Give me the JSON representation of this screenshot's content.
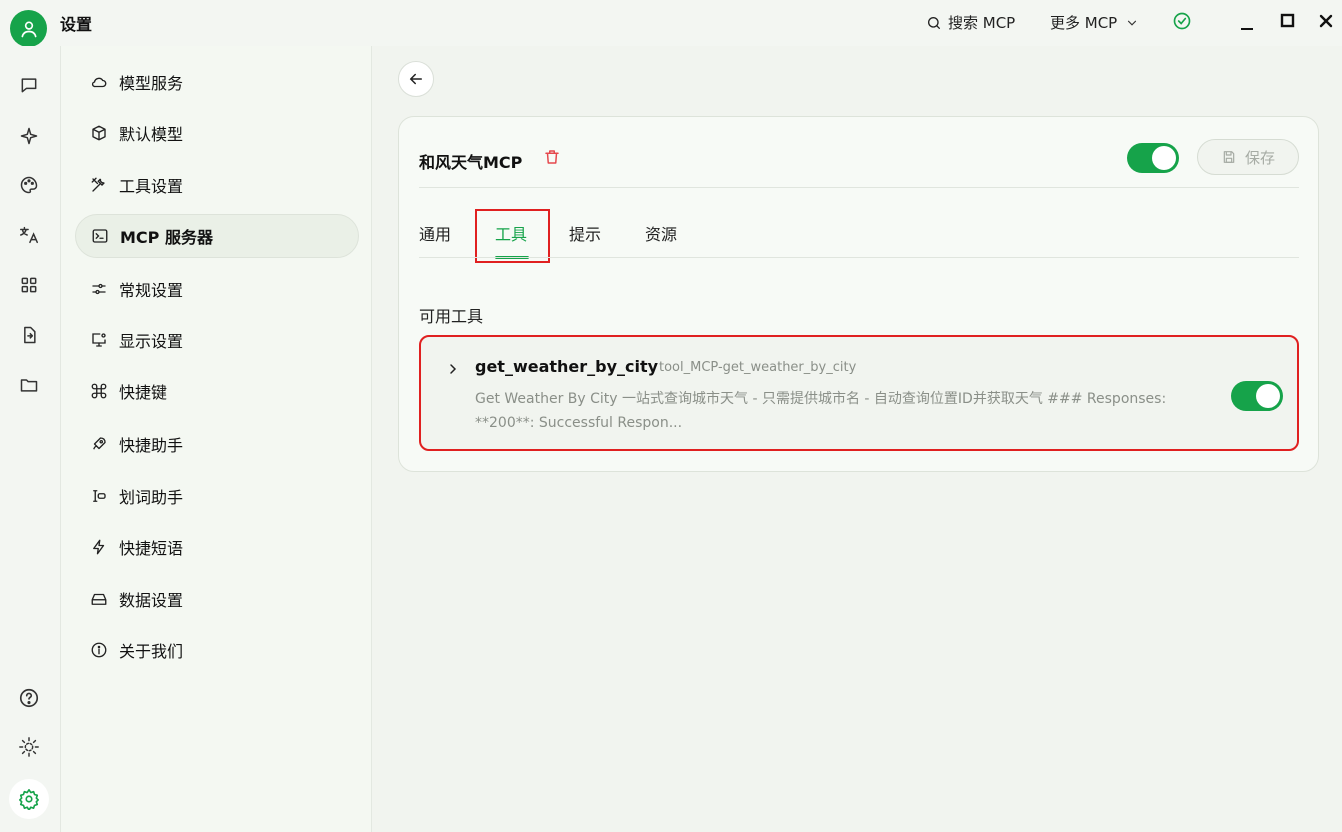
{
  "app": {
    "title": "设置"
  },
  "topbar": {
    "search_label": "搜索 MCP",
    "more_label": "更多 MCP"
  },
  "rail": {
    "icons": [
      "chat-icon",
      "sparkle-icon",
      "palette-icon",
      "translate-icon",
      "apps-icon",
      "file-transfer-icon",
      "folder-icon",
      "help-icon",
      "theme-icon",
      "settings-icon"
    ]
  },
  "menu": {
    "items": [
      {
        "label": "模型服务",
        "icon": "cloud-icon"
      },
      {
        "label": "默认模型",
        "icon": "cube-icon"
      },
      {
        "label": "工具设置",
        "icon": "tools-icon"
      },
      {
        "label": "MCP 服务器",
        "icon": "terminal-icon"
      },
      {
        "label": "常规设置",
        "icon": "sliders-icon"
      },
      {
        "label": "显示设置",
        "icon": "monitor-icon"
      },
      {
        "label": "快捷键",
        "icon": "command-icon"
      },
      {
        "label": "快捷助手",
        "icon": "rocket-icon"
      },
      {
        "label": "划词助手",
        "icon": "text-cursor-icon"
      },
      {
        "label": "快捷短语",
        "icon": "zap-icon"
      },
      {
        "label": "数据设置",
        "icon": "storage-icon"
      },
      {
        "label": "关于我们",
        "icon": "info-icon"
      }
    ],
    "active_index": 3
  },
  "server": {
    "name": "和风天气MCP",
    "enabled": true,
    "save_label": "保存"
  },
  "tabs": [
    {
      "label": "通用"
    },
    {
      "label": "工具"
    },
    {
      "label": "提示"
    },
    {
      "label": "资源"
    }
  ],
  "active_tab": 1,
  "tools_section": {
    "label": "可用工具",
    "items": [
      {
        "name": "get_weather_by_city",
        "id": "tool_MCP-get_weather_by_city",
        "description": "Get Weather By City 一站式查询城市天气 - 只需提供城市名 - 自动查询位置ID并获取天气 ### Responses: **200**: Successful Respon...",
        "enabled": true
      }
    ]
  },
  "colors": {
    "accent": "#16a34a",
    "highlight_box": "#e02020",
    "danger": "#e5484d"
  }
}
